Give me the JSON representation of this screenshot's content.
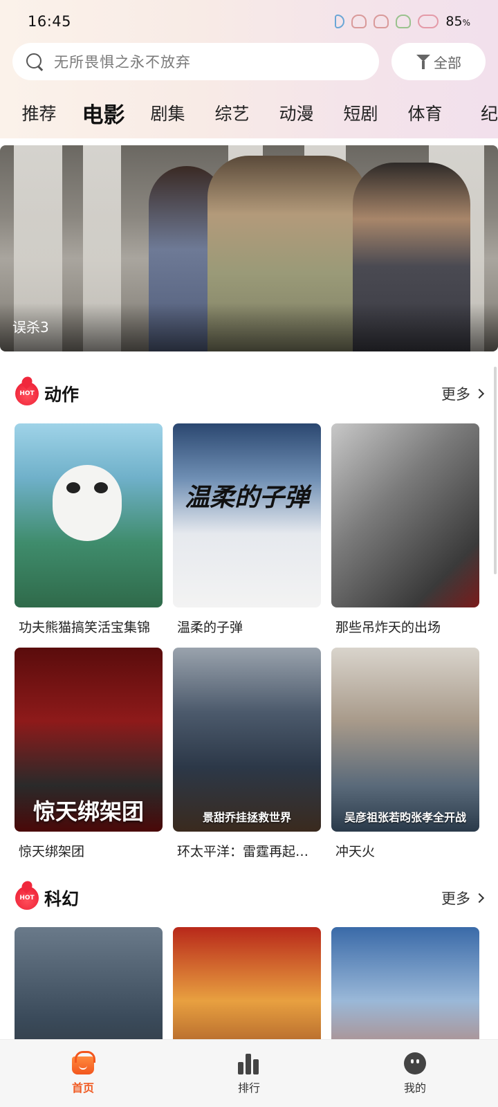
{
  "status_bar": {
    "time": "16:45",
    "battery": "85",
    "battery_unit": "%"
  },
  "search": {
    "placeholder": "无所畏惧之永不放弃",
    "filter_label": "全部"
  },
  "categories": [
    "推荐",
    "电影",
    "剧集",
    "综艺",
    "动漫",
    "短剧",
    "体育",
    "纪"
  ],
  "active_category": "电影",
  "banner": {
    "title": "误杀3"
  },
  "sections": [
    {
      "badge": "HOT",
      "title": "动作",
      "more": "更多",
      "items": [
        {
          "title": "功夫熊猫搞笑活宝集锦"
        },
        {
          "title": "温柔的子弹",
          "poster_text": "温柔的子弹"
        },
        {
          "title": "那些吊炸天的出场"
        },
        {
          "title": "惊天绑架团",
          "poster_text": "惊天绑架团"
        },
        {
          "title": "环太平洋：雷霆再起…",
          "poster_text": "景甜乔挂拯救世界"
        },
        {
          "title": "冲天火",
          "poster_text": "吴彦祖张若昀张孝全开战"
        }
      ]
    },
    {
      "badge": "HOT",
      "title": "科幻",
      "more": "更多",
      "items": [
        {
          "title": ""
        },
        {
          "title": ""
        },
        {
          "title": ""
        }
      ]
    }
  ],
  "bottom_nav": [
    {
      "label": "首页",
      "icon": "home-icon",
      "active": true
    },
    {
      "label": "排行",
      "icon": "ranking-icon",
      "active": false
    },
    {
      "label": "我的",
      "icon": "profile-icon",
      "active": false
    }
  ],
  "colors": {
    "accent": "#f05a22",
    "hot": "#f0283c"
  }
}
